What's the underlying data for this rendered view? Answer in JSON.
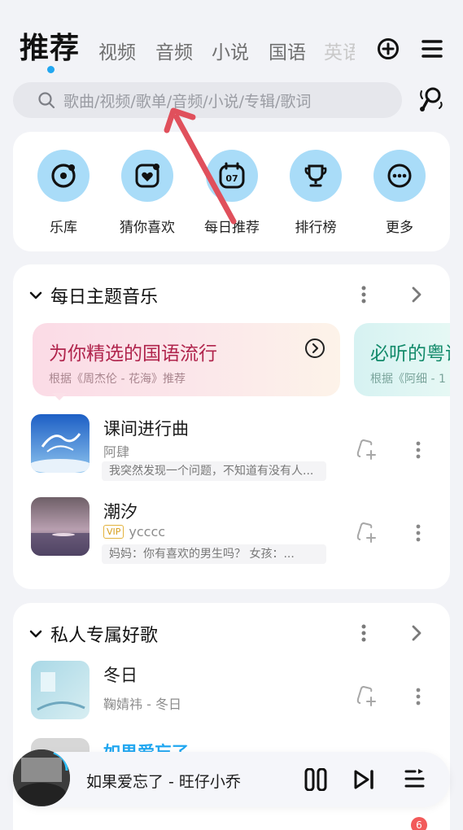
{
  "header": {
    "active_tab": "推荐",
    "tabs": [
      "视频",
      "音频",
      "小说",
      "国语",
      "英语"
    ]
  },
  "search": {
    "placeholder": "歌曲/视频/歌单/音频/小说/专辑/歌词"
  },
  "shortcuts": [
    {
      "label": "乐库",
      "icon": "disc-icon"
    },
    {
      "label": "猜你喜欢",
      "icon": "heart-photo-icon"
    },
    {
      "label": "每日推荐",
      "icon": "calendar-icon",
      "day": "07"
    },
    {
      "label": "排行榜",
      "icon": "trophy-icon"
    },
    {
      "label": "更多",
      "icon": "more-icon"
    }
  ],
  "daily": {
    "title": "每日主题音乐",
    "banners": [
      {
        "title": "为你精选的国语流行",
        "sub": "根据《周杰伦 - 花海》推荐"
      },
      {
        "title": "必听的粤语",
        "sub": "根据《阿细 - 1"
      }
    ],
    "songs": [
      {
        "title": "课间进行曲",
        "artist": "阿肆",
        "vip": false,
        "comment": "我突然发现一个问题，不知道有没有人..."
      },
      {
        "title": "潮汐",
        "artist": "ycccc",
        "vip": true,
        "vip_label": "VIP",
        "comment": "妈妈：你有喜欢的男生吗？ 女孩：..."
      }
    ]
  },
  "private": {
    "title": "私人专属好歌",
    "songs": [
      {
        "title": "冬日",
        "artist": "鞠婧祎 - 冬日"
      },
      {
        "title": "如果爱忘了"
      }
    ]
  },
  "player": {
    "now_playing": "如果爱忘了 - 旺仔小乔"
  },
  "bottom_nav": {
    "badge": "6"
  },
  "colors": {
    "accent": "#22a7f0",
    "icon_circle": "#a9dcf8",
    "banner_title": "#b0244c"
  }
}
